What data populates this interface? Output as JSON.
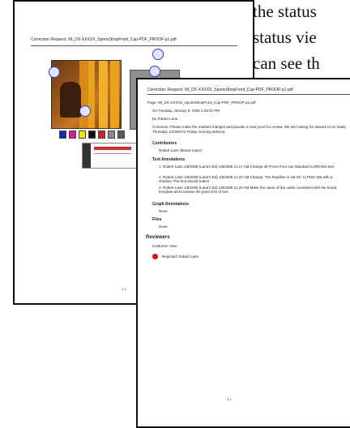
{
  "body_text": {
    "line1": "the status",
    "line2": "status vie",
    "line3": "can see th"
  },
  "back_page": {
    "title": "Correction Request: 99_DX-XXXXX_SportsShopFront_Cup-PDF_PROOF-p1.pdf",
    "swatch_colors": [
      "#1a2aa8",
      "#d91aa0",
      "#f2e01a",
      "#111111",
      "#c82a2a",
      "#8a8a8a",
      "#5a5a5a"
    ],
    "page_number": "1-1"
  },
  "front_page": {
    "title": "Correction Request: 99_DX-XXXXX_SportsShopFront_Cup-PDF_PROOF-p1.pdf",
    "page_line": "Page: 99_DX-XXXXX_SportsShopFront_Cup-PDF_PROOF-p1.pdf",
    "date_line": "On Tuesday, January 8, 2008 1:29:41 PM",
    "by_line": "By Robert Lane",
    "comment": "Comment: Please make the marked changes and provide a new proof for review. We are looking for artwork to be ready Thursday 1/10/08 for Friday morning delivery.",
    "contributor_label": "Contributors",
    "contributor_value": "Robert Lane (Brand Layer)",
    "text_annotations_label": "Text Annotations",
    "annotations": [
      "1. Robert Lane 1/8/2008 (Lane's Ed) 1/8/2008 11:17 AM  Change all Prices from low Standard to BRAND text",
      "2. Robert Lane 1/8/2008 (Lane's Ed) 1/8/2008 11:22 AM  Change: The headline is set 25° to PMS 185 with a shadow. The text should match.",
      "3. Robert Lane 1/8/2008 (Lane's Ed) 1/8/2008 11:28 AM  Make the name of the outlet consistent with the brand template and increase the point size of text."
    ],
    "graph_annotations_label": "Graph Annotations",
    "graph_value": "None",
    "files_label": "Files",
    "files_value": "None",
    "reviewers_label": "Reviewers",
    "customer_view_label": "Customer View",
    "rejected_line": "Rejected: Robert Lane",
    "page_number": "4-1"
  }
}
